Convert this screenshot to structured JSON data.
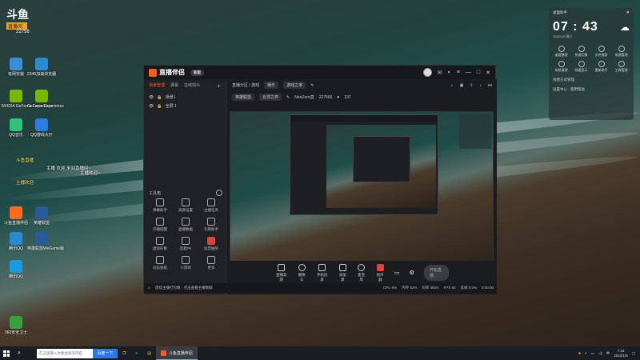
{
  "desktop": {
    "top_logo": "斗鱼",
    "top_logo_sub": "直播间",
    "top_logo_num": "22756",
    "icons": [
      {
        "label": "有网安装",
        "color": "#3c8dd8"
      },
      {
        "label": "2345加速浏览器",
        "color": "#2a8ad4"
      },
      {
        "label": "NVIDIA GeForce Experience",
        "color": "#76b900"
      },
      {
        "label": "GeForce Experience",
        "color": "#76b900"
      },
      {
        "label": "QQ音乐",
        "color": "#31c27c"
      },
      {
        "label": "QQ游戏大厅",
        "color": "#2a7ee0"
      },
      {
        "label": "斗鱼直播",
        "color": "#ff6a1f"
      },
      {
        "label": "斗鱼伴侣",
        "color": "#ff6a1f"
      },
      {
        "label": "斗鱼直播",
        "color": "#ff6a1f"
      },
      {
        "label": "WeGame",
        "color": "#e0a020"
      },
      {
        "label": "斗鱼直播伴侣",
        "color": "#ff6a1f"
      },
      {
        "label": "英雄联盟",
        "color": "#2a5a9a"
      },
      {
        "label": "腾讯QQ",
        "color": "#2a8ad4"
      },
      {
        "label": "英雄联盟WeGame版",
        "color": "#2a5a9a"
      },
      {
        "label": "腾讯QQ",
        "color": "#1a9ae0"
      },
      {
        "label": "360安全卫士",
        "color": "#3aa03a"
      }
    ],
    "chat_lines": [
      "斗鱼直播",
      "主播 欢迎 来到直播间~",
      "主播欢迎~",
      "主播欢迎"
    ]
  },
  "window": {
    "app_name": "直播伴侣",
    "version_badge": "新版",
    "left_tabs": [
      "场景管理",
      "弹幕",
      "在线观众"
    ],
    "scenes": [
      "场景1",
      "全屏 1"
    ],
    "tools_label": "工具箱",
    "tools": [
      "弹幕助手",
      "美颜设置",
      "主播任务",
      "开播提醒",
      "直播数据",
      "礼物助手",
      "虚拟形象",
      "连麦PK",
      "投票抽奖",
      "动态贴纸",
      "小游戏",
      "更多"
    ],
    "top_info": {
      "room": "直播分区 / 游戏",
      "cat": "娱乐",
      "title_chip": "游戏之家",
      "sub1": "英雄联盟",
      "sub2": "云顶之弈",
      "stat_name": "NeoZero直",
      "stat_num": "227566",
      "stat_likes": "137"
    },
    "bottom_buttons": [
      "直播美颜",
      "摄像头",
      "手机投屏",
      "添加源",
      "麦克风",
      "扬声器"
    ],
    "start_live": "开始直播",
    "status_text": "后续主播打包数 · 点击查看主播数据",
    "status_right": [
      "CPU 8%",
      "内存 52%",
      "码率 0kb/s",
      "FPS 60",
      "丢帧 0.0%",
      "0:00:00"
    ]
  },
  "widget": {
    "title": "桌面助手",
    "clock": "07 : 43",
    "date": "2022/1/5 周三",
    "grid": [
      "桌面整理",
      "快速切换",
      "文件搜索",
      "电源管理",
      "系统清理",
      "网速显示",
      "更新助手",
      "工具管理"
    ],
    "link1": "快捷方式管理",
    "link2": "设置中心 · 使用帮助"
  },
  "taskbar": {
    "search_placeholder": "在这里输入你要搜索的内容",
    "search_button": "百度一下",
    "active_app": "斗鱼直播伴侣",
    "time": "7:43",
    "date": "2022/1/5"
  }
}
